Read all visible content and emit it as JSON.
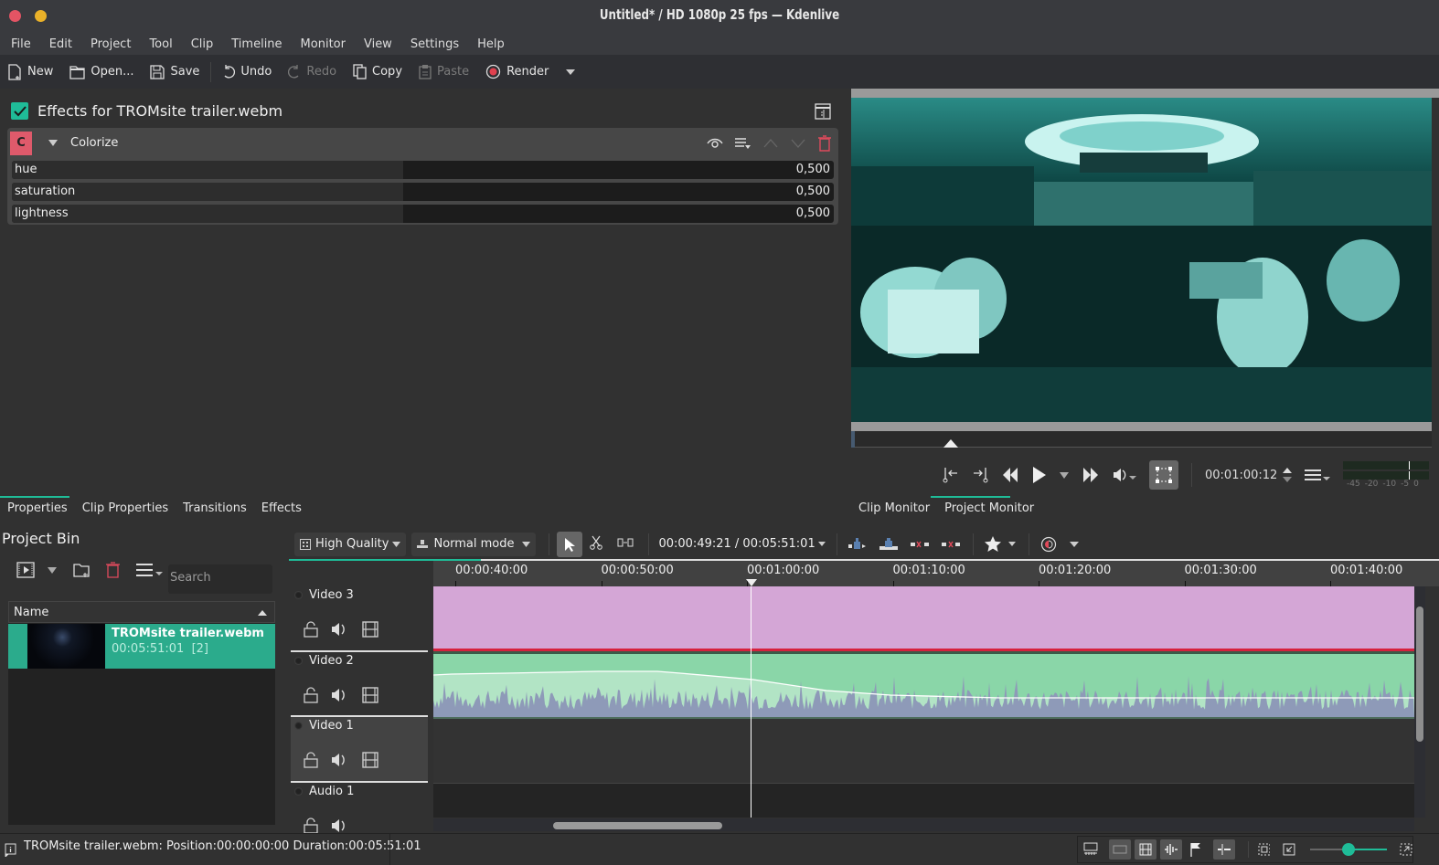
{
  "window": {
    "title": "Untitled* / HD 1080p 25 fps — Kdenlive",
    "close_color": "#e35464",
    "minimize_color": "#eab129"
  },
  "menu": [
    "File",
    "Edit",
    "Project",
    "Tool",
    "Clip",
    "Timeline",
    "Monitor",
    "View",
    "Settings",
    "Help"
  ],
  "toolbar": {
    "new": "New",
    "open": "Open...",
    "save": "Save",
    "undo": "Undo",
    "redo": "Redo",
    "copy": "Copy",
    "paste": "Paste",
    "render": "Render"
  },
  "effects": {
    "title": "Effects for TROMsite trailer.webm",
    "enabled": true,
    "effect": {
      "badge": "C",
      "name": "Colorize",
      "params": [
        {
          "label": "hue",
          "value": "0,500",
          "fraction": 0.5
        },
        {
          "label": "saturation",
          "value": "0,500",
          "fraction": 0.5
        },
        {
          "label": "lightness",
          "value": "0,500",
          "fraction": 0.5
        }
      ]
    }
  },
  "left_tabs": [
    "Properties",
    "Clip Properties",
    "Transitions",
    "Effects"
  ],
  "right_tabs": [
    "Clip Monitor",
    "Project Monitor"
  ],
  "monitor": {
    "timecode": "00:01:00:12",
    "audio_meter_labels": [
      "-45",
      "-20",
      "-10",
      "-5",
      "0"
    ]
  },
  "bin": {
    "title": "Project Bin",
    "search_placeholder": "Search",
    "column_name": "Name",
    "items": [
      {
        "name": "TROMsite trailer.webm",
        "duration": "00:05:51:01",
        "usage": "[2]"
      }
    ]
  },
  "timeline": {
    "quality": "High Quality",
    "mode": "Normal mode",
    "position": "00:00:49:21 / 00:05:51:01",
    "ruler": [
      "00:00:40:00",
      "00:00:50:00",
      "00:01:00:00",
      "00:01:10:00",
      "00:01:20:00",
      "00:01:30:00",
      "00:01:40:00"
    ],
    "tracks": [
      {
        "name": "Video 3"
      },
      {
        "name": "Video 2"
      },
      {
        "name": "Video 1"
      },
      {
        "name": "Audio 1"
      }
    ],
    "colors": {
      "clip_v3": "#d4a6d6",
      "clip_v2": "#8ad6a8",
      "audio_wave": "#8e9ab8",
      "accent": "#1fbc98"
    }
  },
  "status": {
    "message": "TROMsite trailer.webm: Position:00:00:00:00 Duration:00:05:51:01",
    "zoom_fraction": 0.5
  }
}
